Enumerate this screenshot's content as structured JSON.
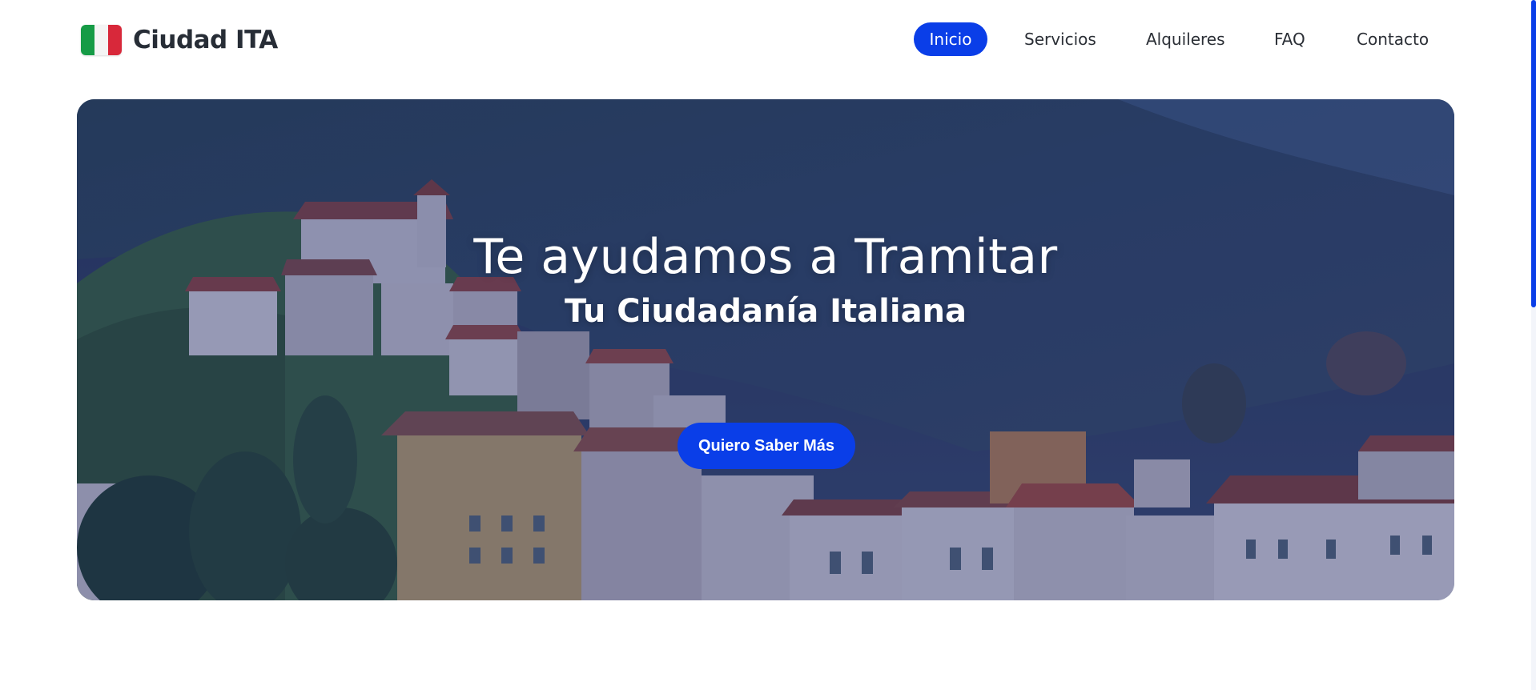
{
  "header": {
    "brand_name": "Ciudad ITA",
    "nav": [
      {
        "label": "Inicio",
        "active": true
      },
      {
        "label": "Servicios",
        "active": false
      },
      {
        "label": "Alquileres",
        "active": false
      },
      {
        "label": "FAQ",
        "active": false
      },
      {
        "label": "Contacto",
        "active": false
      }
    ]
  },
  "hero": {
    "title": "Te ayudamos a Tramitar",
    "subtitle": "Tu Ciudadanía Italiana",
    "cta_label": "Quiero Saber Más"
  },
  "colors": {
    "accent": "#0a3ee8",
    "text": "#272d36",
    "flag_green": "#169b46",
    "flag_white": "#f4f4f4",
    "flag_red": "#d8283a"
  },
  "icons": {
    "brand_logo": "italian-flag-icon"
  }
}
